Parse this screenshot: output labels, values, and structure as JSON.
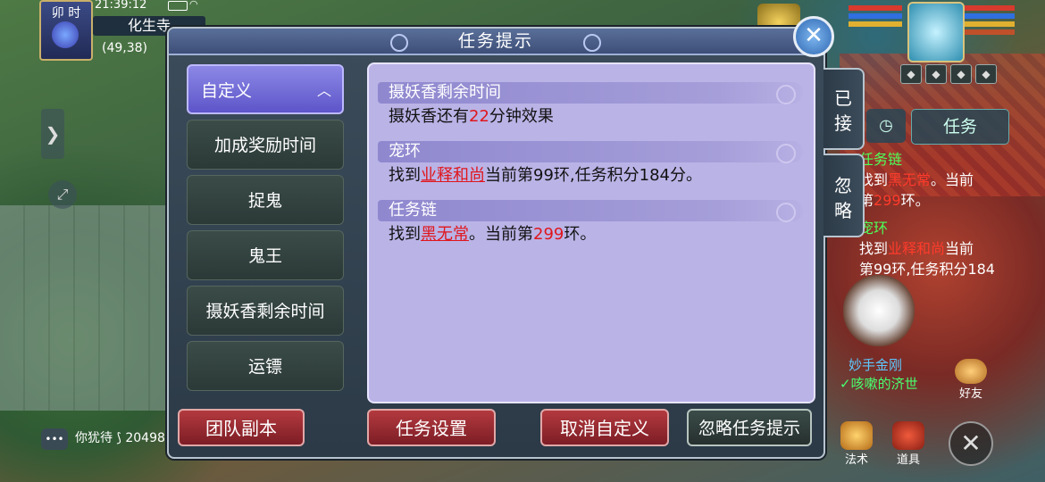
{
  "status": {
    "shichen": "卯 时",
    "clock": "21:39:12",
    "location": "化生寺",
    "coords": "(49,38)"
  },
  "dialog": {
    "title": "任务提示",
    "close_label": "✕",
    "categories": [
      {
        "label": "自定义",
        "active": true
      },
      {
        "label": "加成奖励时间"
      },
      {
        "label": "捉鬼"
      },
      {
        "label": "鬼王"
      },
      {
        "label": "摄妖香剩余时间"
      },
      {
        "label": "运镖"
      }
    ],
    "sections": [
      {
        "title": "摄妖香剩余时间",
        "parts": [
          {
            "text": "摄妖香还有"
          },
          {
            "text": "22",
            "style": "red"
          },
          {
            "text": "分钟效果"
          }
        ]
      },
      {
        "title": "宠环",
        "parts": [
          {
            "text": "找到"
          },
          {
            "text": "业释和尚",
            "style": "link"
          },
          {
            "text": "当前第99环,任务积分184分。"
          }
        ]
      },
      {
        "title": "任务链",
        "parts": [
          {
            "text": "找到"
          },
          {
            "text": "黑无常",
            "style": "link"
          },
          {
            "text": "。当前第"
          },
          {
            "text": "299",
            "style": "red"
          },
          {
            "text": "环。"
          }
        ]
      }
    ],
    "buttons": {
      "team_dungeon": "团队副本",
      "task_settings": "任务设置",
      "cancel_custom": "取消自定义",
      "ignore_tips": "忽略任务提示"
    },
    "side_tabs": {
      "accepted": "已接",
      "ignore": "忽略"
    }
  },
  "hud": {
    "task_tab": "任务",
    "side_lines": [
      {
        "parts": [
          {
            "text": "任务链",
            "style": "green"
          }
        ]
      },
      {
        "parts": [
          {
            "text": "找到"
          },
          {
            "text": "黑无常",
            "style": "red"
          },
          {
            "text": "。当前"
          }
        ]
      },
      {
        "parts": [
          {
            "text": "第"
          },
          {
            "text": "299",
            "style": "red"
          },
          {
            "text": "环。"
          }
        ]
      },
      {
        "parts": [
          {
            "text": "宠环",
            "style": "green"
          }
        ]
      },
      {
        "parts": [
          {
            "text": "找到"
          },
          {
            "text": "业释和尚",
            "style": "red"
          },
          {
            "text": "当前"
          }
        ]
      },
      {
        "parts": [
          {
            "text": "第99环,任务积分184"
          }
        ]
      }
    ],
    "npc_name": "妙手金刚",
    "npc_title": "✓咳嗽的济世",
    "friend_label": "好友",
    "skill_label": "法术",
    "item_label": "道具",
    "chat_preview": "你犹待 ⟆ 20498",
    "colors": {
      "accent_purple": "#8c88e6",
      "panel": "#bab3e6",
      "button_red": "#b33a3f",
      "highlight_red": "#e0161c"
    }
  }
}
